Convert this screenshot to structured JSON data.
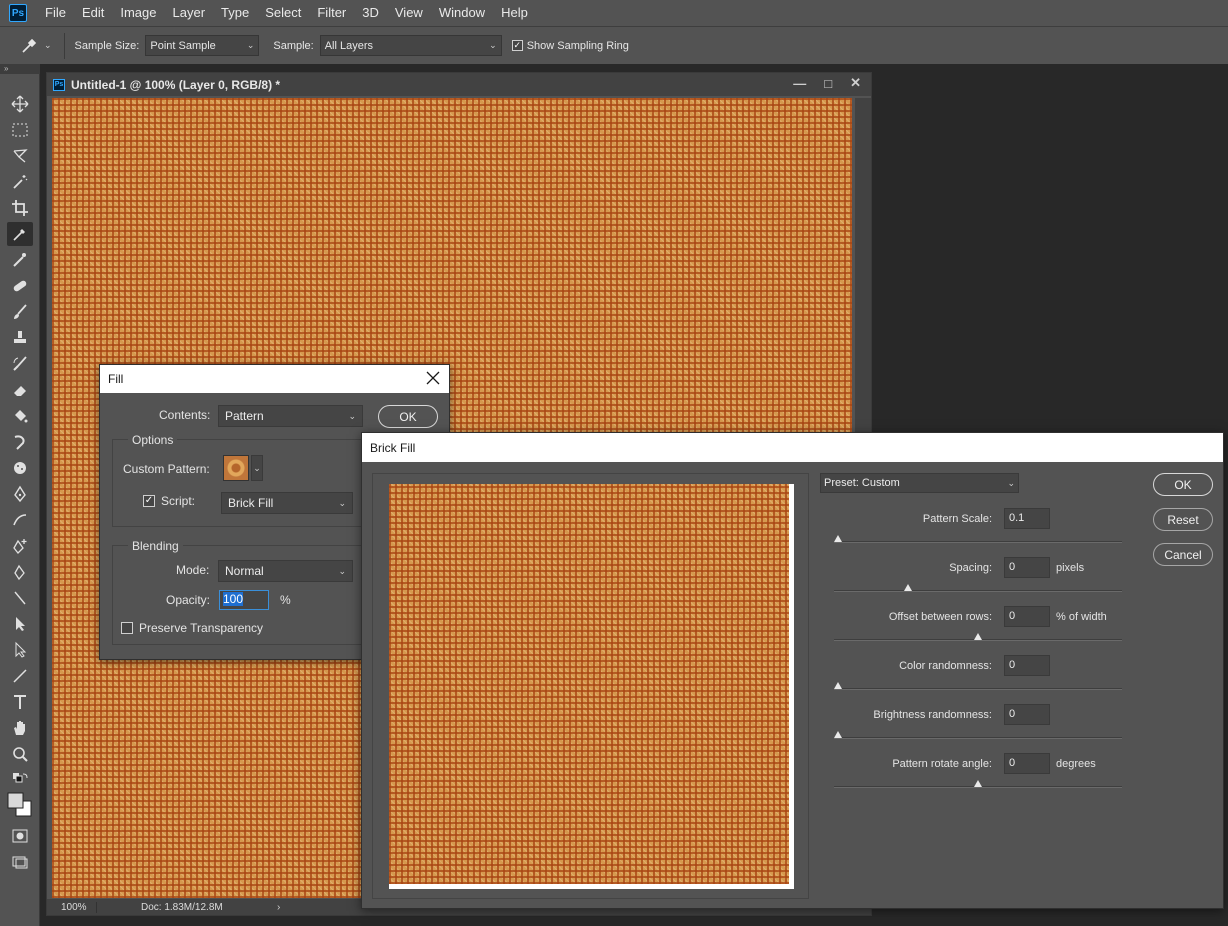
{
  "app": {
    "menu": [
      "File",
      "Edit",
      "Image",
      "Layer",
      "Type",
      "Select",
      "Filter",
      "3D",
      "View",
      "Window",
      "Help"
    ]
  },
  "options_bar": {
    "sample_size_label": "Sample Size:",
    "sample_size_value": "Point Sample",
    "sample_label": "Sample:",
    "sample_value": "All Layers",
    "show_ring_label": "Show Sampling Ring",
    "show_ring_checked": true
  },
  "document": {
    "title": "Untitled-1 @ 100% (Layer 0, RGB/8) *",
    "zoom": "100%",
    "doc_info": "Doc: 1.83M/12.8M"
  },
  "fill_dialog": {
    "title": "Fill",
    "contents_label": "Contents:",
    "contents_value": "Pattern",
    "ok_label": "OK",
    "options_group": "Options",
    "custom_pattern_label": "Custom Pattern:",
    "script_label": "Script:",
    "script_checked": true,
    "script_value": "Brick Fill",
    "blending_group": "Blending",
    "mode_label": "Mode:",
    "mode_value": "Normal",
    "opacity_label": "Opacity:",
    "opacity_value": "100",
    "opacity_unit": "%",
    "preserve_label": "Preserve Transparency",
    "preserve_checked": false
  },
  "brick_dialog": {
    "title": "Brick Fill",
    "preset": "Preset: Custom",
    "ok_label": "OK",
    "reset_label": "Reset",
    "cancel_label": "Cancel",
    "params": [
      {
        "label": "Pattern Scale:",
        "value": "0.1",
        "unit": "",
        "slider_fraction": 0.0
      },
      {
        "label": "Spacing:",
        "value": "0",
        "unit": "pixels",
        "slider_fraction": 0.25
      },
      {
        "label": "Offset between rows:",
        "value": "0",
        "unit": "% of width",
        "slider_fraction": 0.5
      },
      {
        "label": "Color randomness:",
        "value": "0",
        "unit": "",
        "slider_fraction": 0.0
      },
      {
        "label": "Brightness randomness:",
        "value": "0",
        "unit": "",
        "slider_fraction": 0.0
      },
      {
        "label": "Pattern rotate angle:",
        "value": "0",
        "unit": "degrees",
        "slider_fraction": 0.5
      }
    ]
  },
  "colors": {
    "ui_panel": "#535353",
    "ui_dark": "#282828",
    "pattern_base": "#d6994e",
    "pattern_line": "#a84412",
    "accent": "#1f6fd1"
  }
}
